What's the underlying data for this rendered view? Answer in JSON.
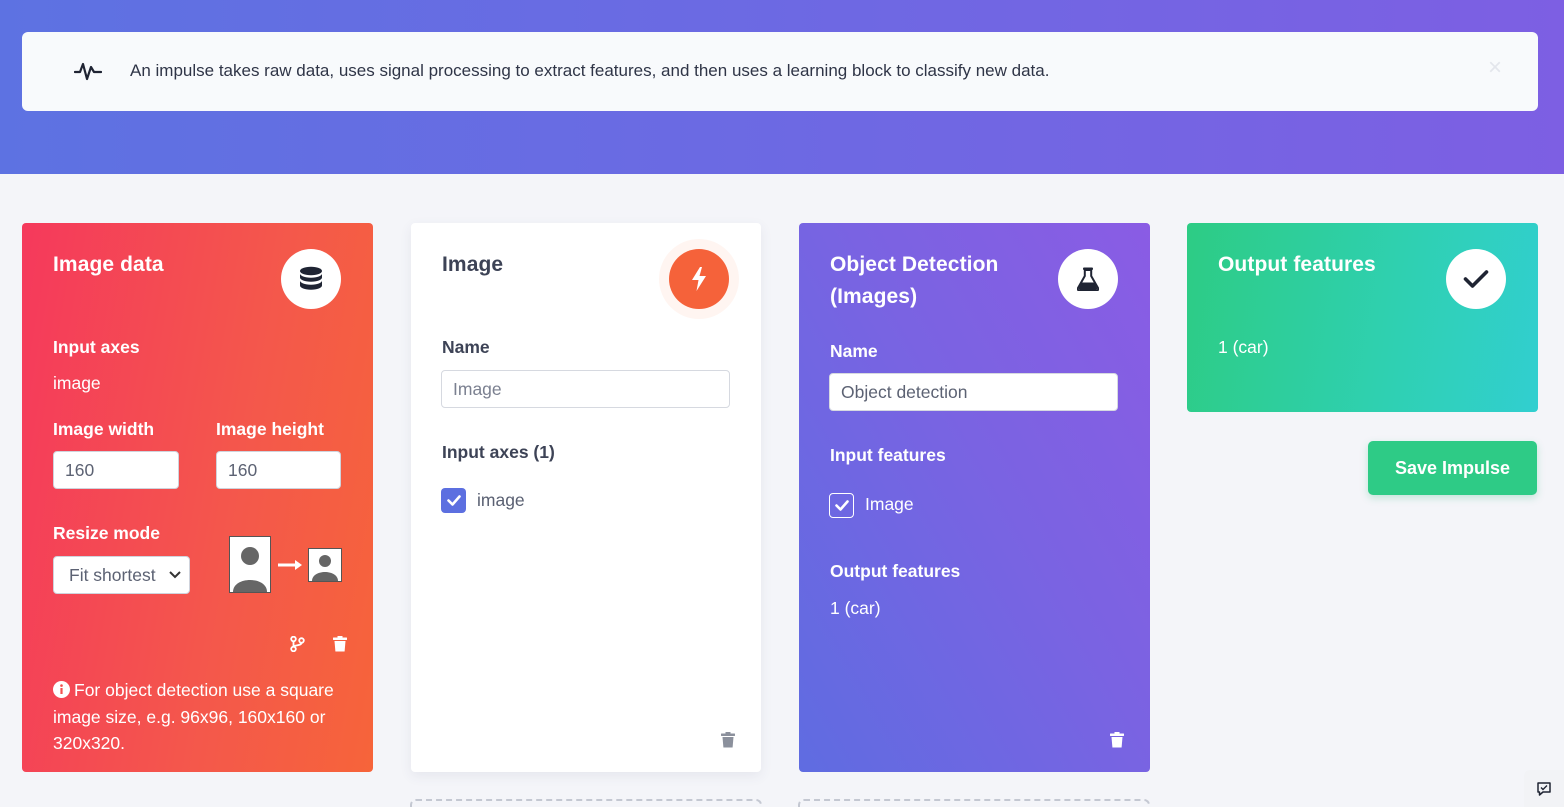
{
  "banner": {
    "message": "An impulse takes raw data, uses signal processing to extract features, and then uses a learning block to classify new data.",
    "icon": "pulse-icon",
    "close_label": "×"
  },
  "image_data": {
    "title": "Image data",
    "icon": "database-icon",
    "input_axes_label": "Input axes",
    "input_axes_value": "image",
    "width_label": "Image width",
    "width_value": "160",
    "height_label": "Image height",
    "height_value": "160",
    "resize_label": "Resize mode",
    "resize_value": "Fit shortest",
    "note": "For object detection use a square image size, e.g. 96x96, 160x160 or 320x320."
  },
  "processing": {
    "title": "Image",
    "icon": "lightning-icon",
    "name_label": "Name",
    "name_placeholder": "Image",
    "axes_label": "Input axes (1)",
    "axes": [
      {
        "label": "image",
        "checked": true
      }
    ]
  },
  "learning": {
    "title_line1": "Object Detection",
    "title_line2": "(Images)",
    "icon": "flask-icon",
    "name_label": "Name",
    "name_placeholder": "Object detection",
    "input_features_label": "Input features",
    "features": [
      {
        "label": "Image",
        "checked": true
      }
    ],
    "output_features_label": "Output features",
    "output_features_value": "1 (car)"
  },
  "output": {
    "title": "Output features",
    "icon": "checkmark-icon",
    "value": "1 (car)"
  },
  "save_button": "Save Impulse",
  "colors": {
    "hero_start": "#5d72e2",
    "hero_end": "#7d5fe3",
    "data_card": "#f4474f",
    "processing_badge": "#f5623a",
    "learning_card": "#6d66e2",
    "output_card": "#2fd0b2",
    "save_button": "#2ecb86"
  }
}
